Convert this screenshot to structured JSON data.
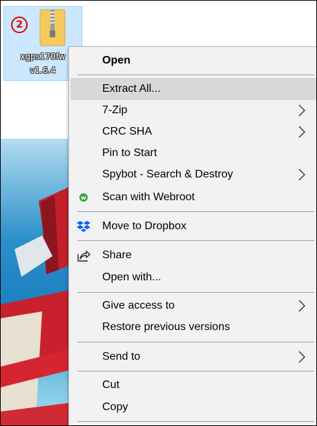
{
  "desktop": {
    "badge": "2",
    "icon_label_line1": "xgps170fw",
    "icon_label_line2": "v1.6.4"
  },
  "context_menu": {
    "items": [
      {
        "label": "Open",
        "bold": true
      },
      {
        "label": "Extract All...",
        "highlighted": true
      },
      {
        "label": "7-Zip",
        "submenu": true
      },
      {
        "label": "CRC SHA",
        "submenu": true
      },
      {
        "label": "Pin to Start"
      },
      {
        "label": "Spybot - Search & Destroy",
        "submenu": true
      },
      {
        "label": "Scan with Webroot",
        "icon": "webroot-icon"
      },
      {
        "label": "Move to Dropbox",
        "icon": "dropbox-icon"
      },
      {
        "label": "Share",
        "icon": "share-icon"
      },
      {
        "label": "Open with..."
      },
      {
        "label": "Give access to",
        "submenu": true
      },
      {
        "label": "Restore previous versions"
      },
      {
        "label": "Send to",
        "submenu": true
      },
      {
        "label": "Cut"
      },
      {
        "label": "Copy"
      }
    ]
  },
  "colors": {
    "menu_bg": "#f2f2f2",
    "highlight": "#d8d8d8",
    "selection": "#cce8ff",
    "badge": "#e00000",
    "dropbox": "#0061fe",
    "webroot": "#3aa335"
  }
}
